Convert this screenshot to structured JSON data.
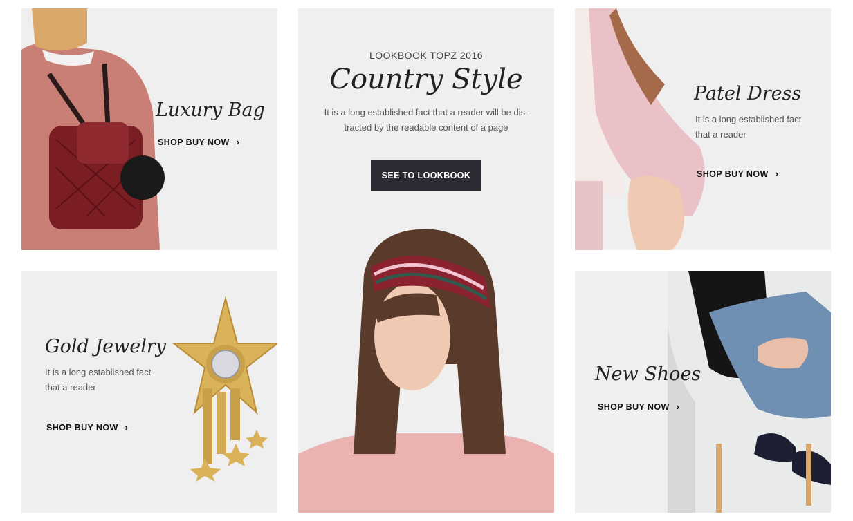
{
  "tiles": {
    "luxury_bag": {
      "title": "Luxury Bag",
      "cta": "SHOP BUY NOW"
    },
    "gold_jewelry": {
      "title": "Gold Jewelry",
      "desc_line1": "It is a long established fact",
      "desc_line2": "that a reader",
      "cta": "SHOP BUY NOW"
    },
    "country_style": {
      "eyebrow": "LOOKBOOK TOPZ 2016",
      "title": "Country Style",
      "desc_line1": "It is a long established fact that a reader will be dis-",
      "desc_line2": "tracted by the readable content of a page",
      "cta": "SEE TO LOOKBOOK"
    },
    "patel_dress": {
      "title": "Patel Dress",
      "desc_line1": "It is a long established fact",
      "desc_line2": "that a reader",
      "cta": "SHOP BUY NOW"
    },
    "new_shoes": {
      "title": "New Shoes",
      "cta": "SHOP BUY NOW"
    }
  },
  "icons": {
    "cta_arrow": "›"
  },
  "colors": {
    "tile_bg": "#efefef",
    "button_bg": "#2e2a33",
    "button_text": "#ffffff"
  }
}
